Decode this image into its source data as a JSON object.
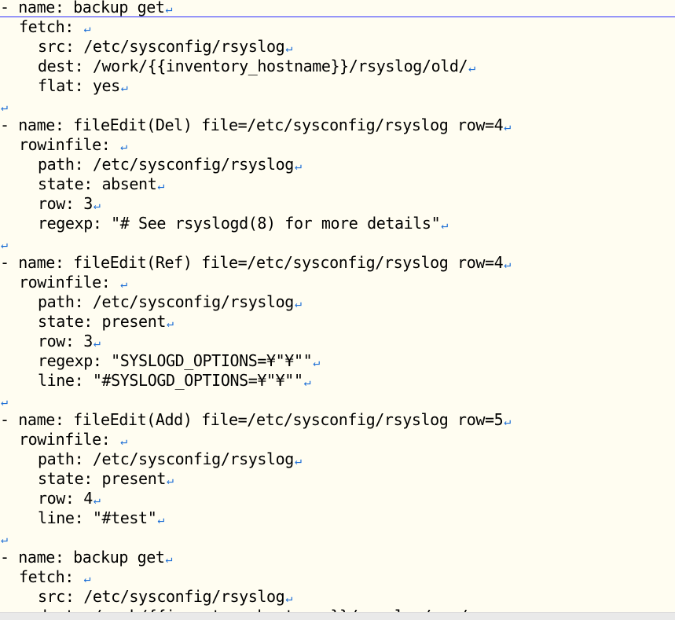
{
  "editor": {
    "newline_marker": "↵",
    "lines": [
      {
        "indent": 0,
        "text": "- name: backup get"
      },
      {
        "indent": 2,
        "text": "fetch: "
      },
      {
        "indent": 4,
        "text": "src: /etc/sysconfig/rsyslog"
      },
      {
        "indent": 4,
        "text": "dest: /work/{{inventory_hostname}}/rsyslog/old/"
      },
      {
        "indent": 4,
        "text": "flat: yes"
      },
      {
        "indent": 0,
        "text": ""
      },
      {
        "indent": 0,
        "text": "- name: fileEdit(Del) file=/etc/sysconfig/rsyslog row=4"
      },
      {
        "indent": 2,
        "text": "rowinfile: "
      },
      {
        "indent": 4,
        "text": "path: /etc/sysconfig/rsyslog"
      },
      {
        "indent": 4,
        "text": "state: absent"
      },
      {
        "indent": 4,
        "text": "row: 3"
      },
      {
        "indent": 4,
        "text": "regexp: \"# See rsyslogd(8) for more details\""
      },
      {
        "indent": 0,
        "text": ""
      },
      {
        "indent": 0,
        "text": "- name: fileEdit(Ref) file=/etc/sysconfig/rsyslog row=4"
      },
      {
        "indent": 2,
        "text": "rowinfile: "
      },
      {
        "indent": 4,
        "text": "path: /etc/sysconfig/rsyslog"
      },
      {
        "indent": 4,
        "text": "state: present"
      },
      {
        "indent": 4,
        "text": "row: 3"
      },
      {
        "indent": 4,
        "text": "regexp: \"SYSLOGD_OPTIONS=¥\"¥\"\""
      },
      {
        "indent": 4,
        "text": "line: \"#SYSLOGD_OPTIONS=¥\"¥\"\""
      },
      {
        "indent": 0,
        "text": ""
      },
      {
        "indent": 0,
        "text": "- name: fileEdit(Add) file=/etc/sysconfig/rsyslog row=5"
      },
      {
        "indent": 2,
        "text": "rowinfile: "
      },
      {
        "indent": 4,
        "text": "path: /etc/sysconfig/rsyslog"
      },
      {
        "indent": 4,
        "text": "state: present"
      },
      {
        "indent": 4,
        "text": "row: 4"
      },
      {
        "indent": 4,
        "text": "line: \"#test\""
      },
      {
        "indent": 0,
        "text": ""
      },
      {
        "indent": 0,
        "text": "- name: backup get"
      },
      {
        "indent": 2,
        "text": "fetch: "
      },
      {
        "indent": 4,
        "text": "src: /etc/sysconfig/rsyslog"
      },
      {
        "indent": 4,
        "text": "dest: /work/{{inventory_hostname}}/rsyslog/new/"
      }
    ]
  }
}
